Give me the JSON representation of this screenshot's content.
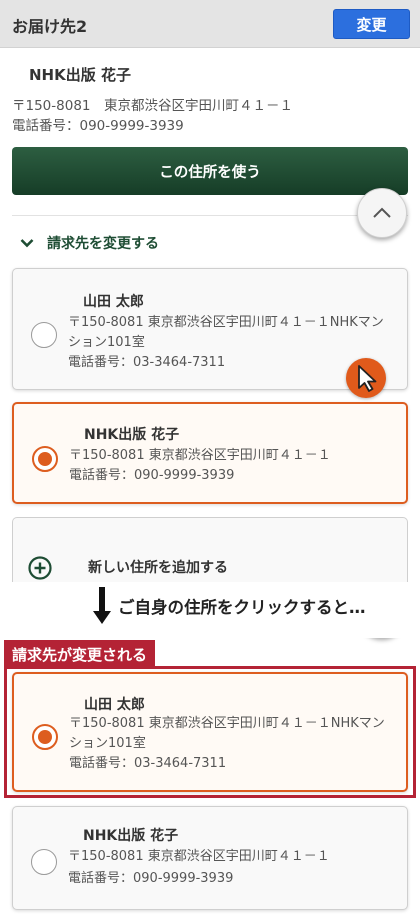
{
  "header": {
    "title": "お届け先2",
    "change_label": "変更"
  },
  "shipping": {
    "name": "NHK出版 花子",
    "address": "〒150-8081　東京都渋谷区宇田川町４１－１",
    "phone": "電話番号：090-9999-3939",
    "use_button_label": "この住所を使う"
  },
  "billing": {
    "toggle_label": "請求先を変更する",
    "cards": [
      {
        "name": "山田 太郎",
        "address_line1": "〒150-8081 東京都渋谷区宇田川町４１－１NHKマン",
        "address_line2": "ション101室",
        "phone": "電話番号：03-3464-7311"
      },
      {
        "name": "NHK出版 花子",
        "address_line1": "〒150-8081 東京都渋谷区宇田川町４１－１",
        "phone": "電話番号：090-9999-3939"
      }
    ],
    "add_label": "新しい住所を追加する"
  },
  "annotation": {
    "caption": "ご自身の住所をクリックすると…",
    "banner": "請求先が変更される"
  },
  "after": {
    "cards": [
      {
        "name": "山田 太郎",
        "address_line1": "〒150-8081 東京都渋谷区宇田川町４１－１NHKマン",
        "address_line2": "ション101室",
        "phone": "電話番号：03-3464-7311"
      },
      {
        "name": "NHK出版 花子",
        "address_line1": "〒150-8081 東京都渋谷区宇田川町４１－１",
        "phone": "電話番号：090-9999-3939"
      }
    ]
  },
  "colors": {
    "accent_orange": "#dd5d1f",
    "primary_green": "#1e4d34",
    "change_blue": "#2c6fde",
    "annotation_red": "#b42335"
  },
  "icons": {
    "scroll_top": "chevron-up-icon",
    "toggle": "chevron-down-icon",
    "add": "plus-circle-icon",
    "cursor": "mouse-pointer-icon",
    "arrow": "arrow-down-icon"
  }
}
